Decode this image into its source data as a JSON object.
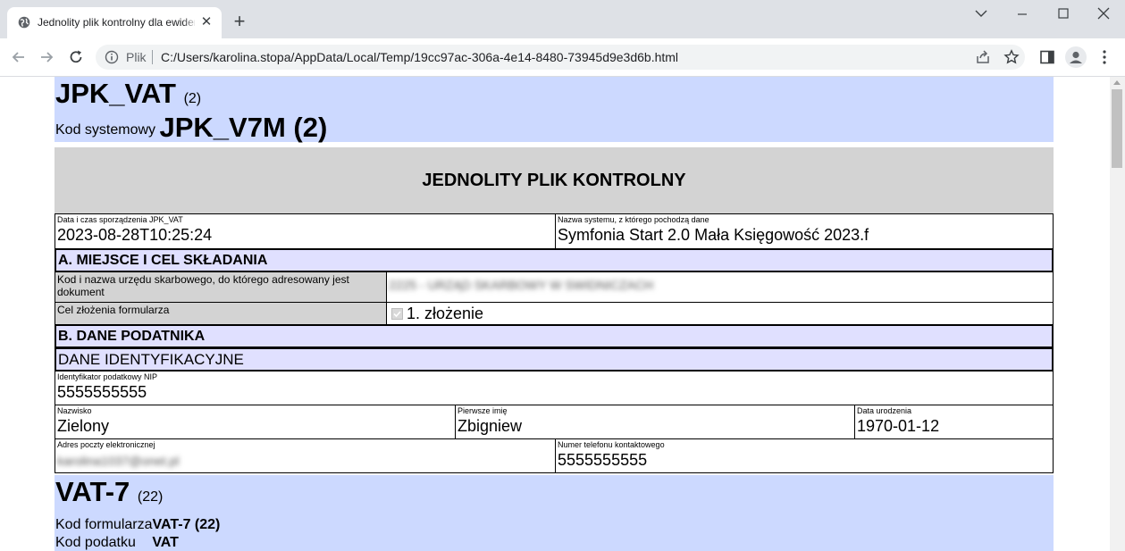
{
  "browser": {
    "tab_title": "Jednolity plik kontrolny dla ewidencji",
    "scheme_label": "Plik",
    "url": "C:/Users/karolina.stopa/AppData/Local/Temp/19cc97ac-306a-4e14-8480-73945d9e3d6b.html"
  },
  "document": {
    "title": "JPK_VAT",
    "title_version": "(2)",
    "system_code_label": "Kod systemowy",
    "system_code_value": "JPK_V7M (2)",
    "banner": "JEDNOLITY PLIK KONTROLNY",
    "created_label": "Data i czas sporządzenia JPK_VAT",
    "created_value": "2023-08-28T10:25:24",
    "system_name_label": "Nazwa systemu, z którego pochodzą dane",
    "system_name_value": "Symfonia Start 2.0 Mała Księgowość 2023.f",
    "section_a": "A. MIEJSCE I CEL SKŁADANIA",
    "office_label": "Kod i nazwa urzędu skarbowego, do którego adresowany jest dokument",
    "office_value": "2225 - URZĄD SKARBOWY W SWIDNICZACH",
    "purpose_label": "Cel złożenia formularza",
    "purpose_value": "1. złożenie",
    "section_b": "B. DANE PODATNIKA",
    "subsection_ident": "DANE IDENTYFIKACYJNE",
    "nip_label": "Identyfikator podatkowy NIP",
    "nip_value": "5555555555",
    "surname_label": "Nazwisko",
    "surname_value": "Zielony",
    "firstname_label": "Pierwsze imię",
    "firstname_value": "Zbigniew",
    "birthdate_label": "Data urodzenia",
    "birthdate_value": "1970-01-12",
    "email_label": "Adres poczty elektronicznej",
    "email_value": "karolina1037@onet.pl",
    "phone_label": "Numer telefonu kontaktowego",
    "phone_value": "5555555555",
    "form_title": "VAT-7",
    "form_version": "(22)",
    "form_code_label": "Kod formularza",
    "form_code_value": "VAT-7 (22)",
    "tax_code_label": "Kod podatku",
    "tax_code_value": "VAT"
  }
}
